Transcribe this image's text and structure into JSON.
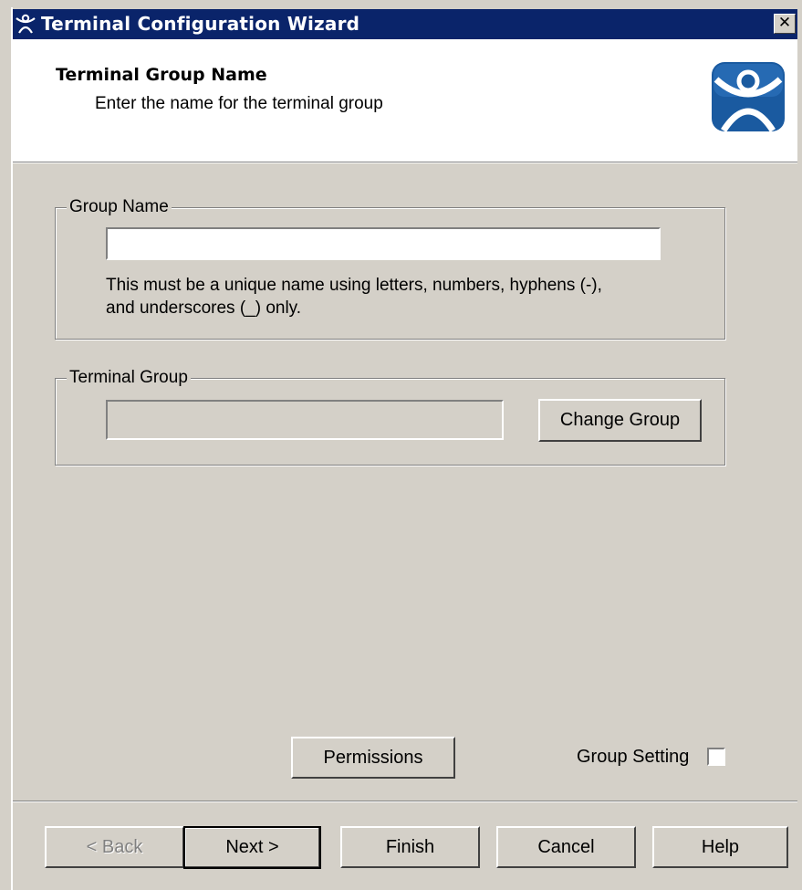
{
  "window": {
    "title": "Terminal Configuration Wizard",
    "close_symbol": "✕",
    "title_icon": "thinmanager-icon"
  },
  "header": {
    "title": "Terminal Group Name",
    "subtitle": "Enter the name for the terminal group",
    "logo": "thinmanager-logo"
  },
  "group_name": {
    "legend": "Group Name",
    "value": "",
    "placeholder": "",
    "hint_line1": "This must be a unique name using letters, numbers, hyphens (-),",
    "hint_line2": "and underscores (_) only."
  },
  "terminal_group": {
    "legend": "Terminal Group",
    "value": "",
    "change_button": "Change Group"
  },
  "options": {
    "permissions_button": "Permissions",
    "group_setting_label": "Group Setting",
    "group_setting_checked": false
  },
  "footer": {
    "back": "< Back",
    "next": "Next >",
    "finish": "Finish",
    "cancel": "Cancel",
    "help": "Help"
  },
  "colors": {
    "titlebar": "#0a246a",
    "dialog_bg": "#d4d0c8",
    "logo_blue": "#1a5aa0"
  }
}
